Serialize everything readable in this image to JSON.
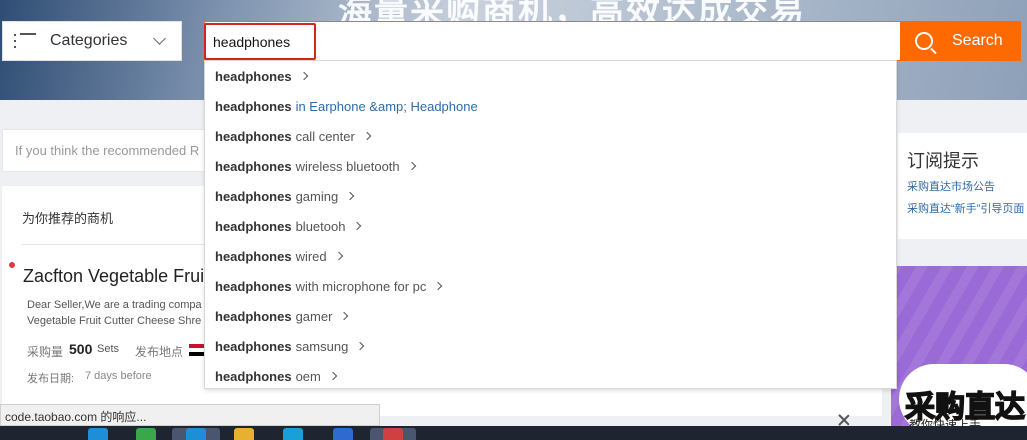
{
  "header": {
    "banner_text": "海量采购商机，高效达成交易",
    "categories_label": "Categories",
    "search": {
      "value": "headphones",
      "button_label": "Search"
    }
  },
  "suggestions": [
    {
      "keyword": "headphones",
      "rest": "",
      "is_category": false
    },
    {
      "keyword": "headphones",
      "rest": "in Earphone &amp; Headphone",
      "is_category": true
    },
    {
      "keyword": "headphones",
      "rest": "call center",
      "is_category": false
    },
    {
      "keyword": "headphones",
      "rest": "wireless bluetooth",
      "is_category": false
    },
    {
      "keyword": "headphones",
      "rest": "gaming",
      "is_category": false
    },
    {
      "keyword": "headphones",
      "rest": "bluetooh",
      "is_category": false
    },
    {
      "keyword": "headphones",
      "rest": "wired",
      "is_category": false
    },
    {
      "keyword": "headphones",
      "rest": "with microphone for pc",
      "is_category": false
    },
    {
      "keyword": "headphones",
      "rest": "gamer",
      "is_category": false
    },
    {
      "keyword": "headphones",
      "rest": "samsung",
      "is_category": false
    },
    {
      "keyword": "headphones",
      "rest": "oem",
      "is_category": false
    }
  ],
  "notice": {
    "text": "If you think the recommended R"
  },
  "recommend": {
    "heading": "为你推荐的商机",
    "item": {
      "title": "Zacfton Vegetable Fruit",
      "desc_line1": "Dear Seller,We are a trading compa",
      "desc_line2": "Vegetable Fruit Cutter Cheese Shre",
      "qty_label": "采购量",
      "qty_value": "500",
      "qty_unit": "Sets",
      "origin_label": "发布地点",
      "date_label": "发布日期:",
      "date_value": "7 days before"
    }
  },
  "side": {
    "title": "订阅提示",
    "link1": "采购直达市场公告",
    "link2": "采购直达“新手”引导页面"
  },
  "ad": {
    "text": "采购直达",
    "subtext": "教你快速上手"
  },
  "status_bar": {
    "text": "code.taobao.com 的响应..."
  },
  "colors": {
    "accent": "#ff6a00",
    "highlight_border": "#d0281c",
    "link": "#2f6aa8"
  }
}
